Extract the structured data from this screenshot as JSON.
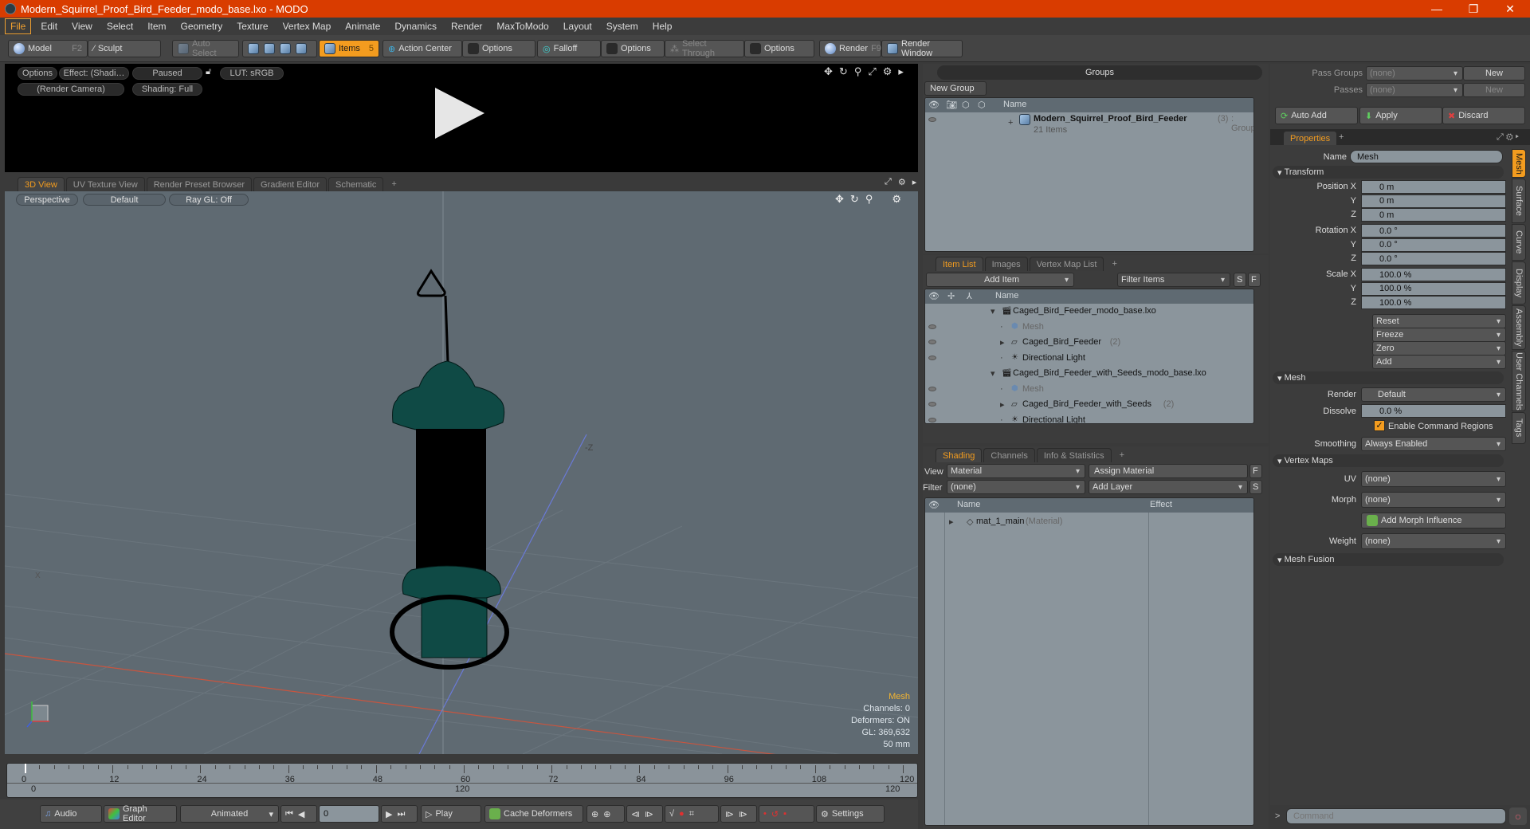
{
  "window": {
    "title": "Modern_Squirrel_Proof_Bird_Feeder_modo_base.lxo - MODO",
    "minimize_icon": "—",
    "restore_icon": "❐",
    "close_icon": "✕"
  },
  "menu": [
    "File",
    "Edit",
    "View",
    "Select",
    "Item",
    "Geometry",
    "Texture",
    "Vertex Map",
    "Animate",
    "Dynamics",
    "Render",
    "MaxToModo",
    "Layout",
    "System",
    "Help"
  ],
  "toolbar": {
    "model": "Model",
    "model_key": "F2",
    "sculpt": "Sculpt",
    "auto_select": "Auto Select",
    "items": "Items",
    "items_key": "5",
    "action_center": "Action Center",
    "options1": "Options",
    "falloff": "Falloff",
    "options2": "Options",
    "select_through": "Select Through",
    "options3": "Options",
    "render": "Render",
    "render_key": "F9",
    "render_window": "Render Window"
  },
  "render_view": {
    "options": "Options",
    "effect": "Effect: (Shadi…",
    "paused": "Paused",
    "lut": "LUT: sRGB",
    "camera": "(Render Camera)",
    "shading": "Shading: Full"
  },
  "viewport_tabs": [
    "3D View",
    "UV Texture View",
    "Render Preset Browser",
    "Gradient Editor",
    "Schematic",
    "+"
  ],
  "viewport": {
    "perspective": "Perspective",
    "default": "Default",
    "raygl": "Ray GL: Off",
    "axis_label": "-Z",
    "axis_label_x": "X",
    "info": {
      "selected": "Mesh",
      "channels": "Channels: 0",
      "deformers": "Deformers: ON",
      "gl": "GL: 369,632",
      "size": "50 mm"
    }
  },
  "timeline": {
    "ticks": [
      "0",
      "12",
      "24",
      "36",
      "48",
      "60",
      "72",
      "84",
      "96",
      "108",
      "120"
    ],
    "range_start": "0",
    "range_mid": "120",
    "range_end": "120",
    "current_frame": 0
  },
  "transport": {
    "audio": "Audio",
    "graph_editor": "Graph Editor",
    "animated": "Animated",
    "frame": "0",
    "play": "Play",
    "cache_deformers": "Cache Deformers",
    "settings": "Settings"
  },
  "groups": {
    "title": "Groups",
    "new_group": "New Group",
    "col_name": "Name",
    "row": {
      "name": "Modern_Squirrel_Proof_Bird_Feeder",
      "count": "(3)",
      "type": ": Group",
      "items": "21 Items"
    }
  },
  "item_list": {
    "tabs": [
      "Item List",
      "Images",
      "Vertex Map List",
      "+"
    ],
    "add_item": "Add Item",
    "filter": "Filter Items",
    "s": "S",
    "f": "F",
    "col_name": "Name",
    "rows": [
      {
        "name": "Caged_Bird_Feeder_modo_base.lxo",
        "suffix": "",
        "level": 0,
        "kind": "scene",
        "dim": false
      },
      {
        "name": "Mesh",
        "suffix": "",
        "level": 1,
        "kind": "mesh",
        "dim": true
      },
      {
        "name": "Caged_Bird_Feeder",
        "suffix": "(2)",
        "level": 1,
        "kind": "group",
        "dim": false
      },
      {
        "name": "Directional Light",
        "suffix": "",
        "level": 1,
        "kind": "light",
        "dim": false
      },
      {
        "name": "Caged_Bird_Feeder_with_Seeds_modo_base.lxo",
        "suffix": "",
        "level": 0,
        "kind": "scene",
        "dim": false
      },
      {
        "name": "Mesh",
        "suffix": "",
        "level": 1,
        "kind": "mesh",
        "dim": true
      },
      {
        "name": "Caged_Bird_Feeder_with_Seeds",
        "suffix": "(2)",
        "level": 1,
        "kind": "group",
        "dim": false
      },
      {
        "name": "Directional Light",
        "suffix": "",
        "level": 1,
        "kind": "light",
        "dim": false
      }
    ]
  },
  "shading": {
    "tabs": [
      "Shading",
      "Channels",
      "Info & Statistics",
      "+"
    ],
    "view_label": "View",
    "view_value": "Material",
    "assign_material": "Assign Material",
    "f": "F",
    "filter_label": "Filter",
    "filter_value": "(none)",
    "add_layer": "Add Layer",
    "s": "S",
    "col_name": "Name",
    "col_effect": "Effect",
    "rows": [
      {
        "name": "mat_1_main",
        "type": "(Material)"
      }
    ]
  },
  "passes": {
    "pass_groups_label": "Pass Groups",
    "pass_groups_value": "(none)",
    "new1": "New",
    "passes_label": "Passes",
    "passes_value": "(none)",
    "new2": "New",
    "auto_add": "Auto Add",
    "apply": "Apply",
    "discard": "Discard"
  },
  "properties": {
    "tab": "Properties",
    "plus": "+",
    "name_label": "Name",
    "name_value": "Mesh",
    "transform": "Transform",
    "position": [
      {
        "label": "Position X",
        "value": "0 m"
      },
      {
        "label": "Y",
        "value": "0 m"
      },
      {
        "label": "Z",
        "value": "0 m"
      }
    ],
    "rotation": [
      {
        "label": "Rotation X",
        "value": "0.0 °"
      },
      {
        "label": "Y",
        "value": "0.0 °"
      },
      {
        "label": "Z",
        "value": "0.0 °"
      }
    ],
    "scale": [
      {
        "label": "Scale X",
        "value": "100.0 %"
      },
      {
        "label": "Y",
        "value": "100.0 %"
      },
      {
        "label": "Z",
        "value": "100.0 %"
      }
    ],
    "actions": [
      "Reset",
      "Freeze",
      "Zero",
      "Add"
    ],
    "mesh_section": "Mesh",
    "render_label": "Render",
    "render_value": "Default",
    "dissolve_label": "Dissolve",
    "dissolve_value": "0.0 %",
    "enable_cmd_regions": "Enable Command Regions",
    "smoothing_label": "Smoothing",
    "smoothing_value": "Always Enabled",
    "vertex_maps": "Vertex Maps",
    "uv_label": "UV",
    "uv_value": "(none)",
    "morph_label": "Morph",
    "morph_value": "(none)",
    "add_morph": "Add Morph Influence",
    "weight_label": "Weight",
    "weight_value": "(none)",
    "mesh_fusion": "Mesh Fusion",
    "side_tabs": [
      "Mesh",
      "Surface",
      "Curve",
      "Display",
      "Assembly",
      "User Channels",
      "Tags"
    ]
  },
  "command": {
    "prompt": ">",
    "placeholder": "Command"
  },
  "colors": {
    "accent": "#f39c1f",
    "titlebar": "#d93c00",
    "mesh_green": "#0f4a45"
  }
}
